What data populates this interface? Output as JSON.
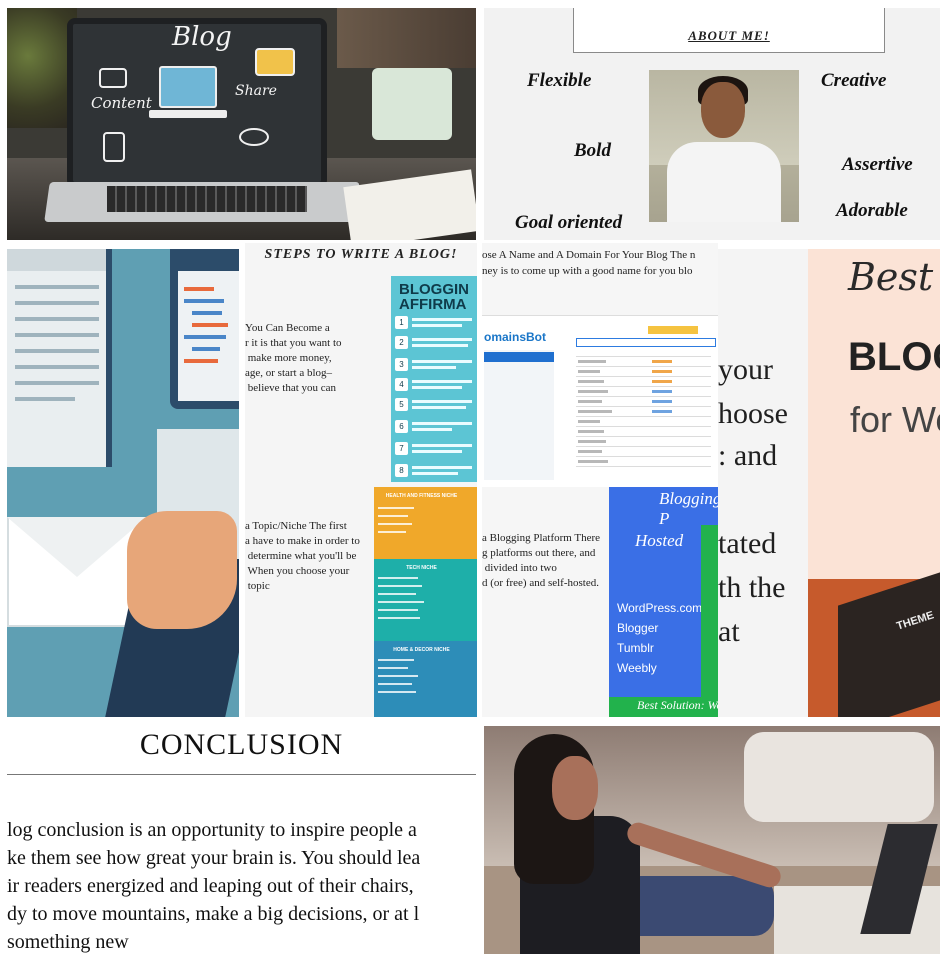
{
  "blog_photo": {
    "title": "Blog",
    "label_content": "Content",
    "label_share": "Share"
  },
  "about": {
    "title": "ABOUT ME!",
    "traits": {
      "flexible": "Flexible",
      "creative": "Creative",
      "bold": "Bold",
      "assertive": "Assertive",
      "goal_oriented": "Goal oriented",
      "adorable": "Adorable"
    }
  },
  "steps": {
    "title": "STEPS TO WRITE A BLOG!",
    "step1_text": "You Can Become a\nr it is that you want to\n make more money,\nage, or start a blog–\n believe that you can",
    "affirmations_title": "BLOGGIN\nAFFIRMA",
    "affirmation_numbers": [
      "1",
      "2",
      "3",
      "4",
      "5",
      "6",
      "7",
      "8"
    ],
    "step2_text": "a Topic/Niche The first\na have to make in order to\n determine what you'll be\n When you choose your\n topic",
    "niche_labels": [
      "HEALTH AND FITNESS NICHE",
      "TECH NICHE",
      "HOME & DECOR NICHE"
    ]
  },
  "domain": {
    "top_text": "ose A Name and A Domain For Your Blog The n\nney is to come up with a good name for you blo",
    "logo_main": "omainsBot",
    "logo_accent": "",
    "bottom_text": "a Blogging Platform There\ng platforms out there, and\n divided into two\nd (or free) and self-hosted.",
    "platform_title": "Blogging P",
    "hosted_label": "Hosted",
    "platforms": [
      "WordPress.com",
      "Blogger",
      "Tumblr",
      "Weebly"
    ],
    "footer_label": "Best Solution: WordP"
  },
  "fragment": {
    "lines": [
      "your",
      "hoose",
      ": and",
      "",
      "tated",
      "th the",
      "at"
    ]
  },
  "best_free": {
    "line1": "Best Fr",
    "line2": "BLOG",
    "line3": "for Wor",
    "badge": "THEME"
  },
  "conclusion": {
    "title": "CONCLUSION",
    "paragraph": "log conclusion is an opportunity to inspire people a\nke them see how great your brain is. You should lea\nir readers energized and leaping out of their chairs,\ndy to move mountains, make a big decisions, or at l\nsomething new"
  },
  "colors": {
    "affirm_bg": "#5cc5d4",
    "niche_orange": "#f0a82a",
    "niche_teal": "#1eafa9",
    "niche_blue": "#2d8db8",
    "platform_blue": "#3a6fe6",
    "platform_green": "#22b24c",
    "best_bg": "#fbe3d6"
  }
}
